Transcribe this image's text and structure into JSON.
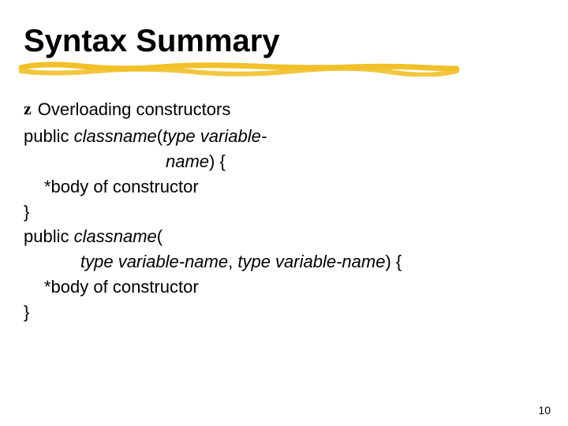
{
  "title": "Syntax Summary",
  "bullet_glyph": "z",
  "bullet_text": "Overloading constructors",
  "lines": {
    "l1a": "public ",
    "l1b": "classname",
    "l1c": "(",
    "l1d": "type variable-",
    "l2a": "name",
    "l2b": ") {",
    "l3": "*body of constructor",
    "l4": "}",
    "l5a": "public ",
    "l5b": "classname",
    "l5c": "(",
    "l6a": "type variable-name",
    "l6b": ", ",
    "l6c": "type variable-name",
    "l6d": ") {",
    "l7": "*body of constructor",
    "l8": "}"
  },
  "page_number": "10"
}
